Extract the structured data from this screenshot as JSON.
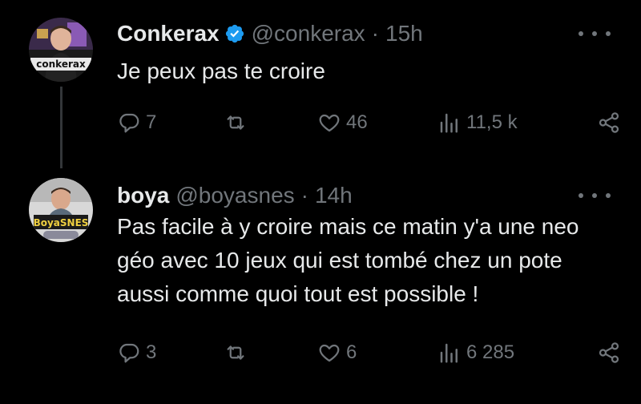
{
  "tweets": [
    {
      "name": "Conkerax",
      "verified": true,
      "handle": "@conkerax",
      "separator": "·",
      "time": "15h",
      "avatar_text": "conkerax",
      "text": "Je peux pas te croire",
      "replies": "7",
      "retweets": "",
      "likes": "46",
      "views": "11,5 k"
    },
    {
      "name": "boya",
      "verified": false,
      "handle": "@boyasnes",
      "separator": "·",
      "time": "14h",
      "avatar_text": "BoyaSNES",
      "text": "Pas facile à y croire mais ce matin y'a une neo géo avec 10 jeux qui est tombé chez un pote aussi comme quoi tout est possible !",
      "replies": "3",
      "retweets": "",
      "likes": "6",
      "views": "6 285"
    }
  ],
  "icons": {
    "reply": "reply-icon",
    "retweet": "retweet-icon",
    "like": "heart-icon",
    "views": "views-icon",
    "share": "share-icon",
    "more": "more-icon",
    "verified": "verified-badge-icon"
  },
  "colors": {
    "background": "#000000",
    "text": "#e7e9ea",
    "muted": "#71767b",
    "verified": "#1d9bf0",
    "thread_line": "#333639"
  }
}
